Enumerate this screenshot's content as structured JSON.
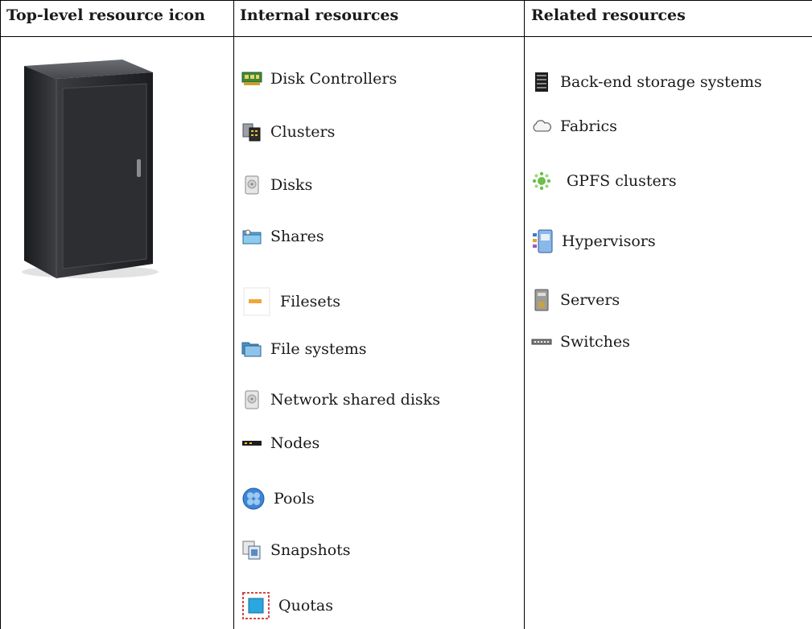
{
  "headers": {
    "col1": "Top-level resource icon",
    "col2": "Internal resources",
    "col3": "Related resources"
  },
  "internal": [
    {
      "label": "Disk Controllers",
      "icon": "disk-controller-icon"
    },
    {
      "label": "Clusters",
      "icon": "clusters-icon"
    },
    {
      "label": "Disks",
      "icon": "disk-icon"
    },
    {
      "label": "Shares",
      "icon": "shares-icon"
    },
    {
      "label": "Filesets",
      "icon": "fileset-icon"
    },
    {
      "label": "File systems",
      "icon": "file-systems-icon"
    },
    {
      "label": "Network shared disks",
      "icon": "network-shared-disk-icon"
    },
    {
      "label": "Nodes",
      "icon": "nodes-icon"
    },
    {
      "label": "Pools",
      "icon": "pools-icon"
    },
    {
      "label": "Snapshots",
      "icon": "snapshots-icon"
    },
    {
      "label": "Quotas",
      "icon": "quotas-icon"
    }
  ],
  "related": [
    {
      "label": "Back-end storage systems",
      "icon": "storage-system-icon"
    },
    {
      "label": "Fabrics",
      "icon": "fabric-cloud-icon"
    },
    {
      "label": "GPFS clusters",
      "icon": "gpfs-cluster-icon"
    },
    {
      "label": "Hypervisors",
      "icon": "hypervisor-icon"
    },
    {
      "label": "Servers",
      "icon": "server-icon"
    },
    {
      "label": "Switches",
      "icon": "switch-icon"
    }
  ]
}
